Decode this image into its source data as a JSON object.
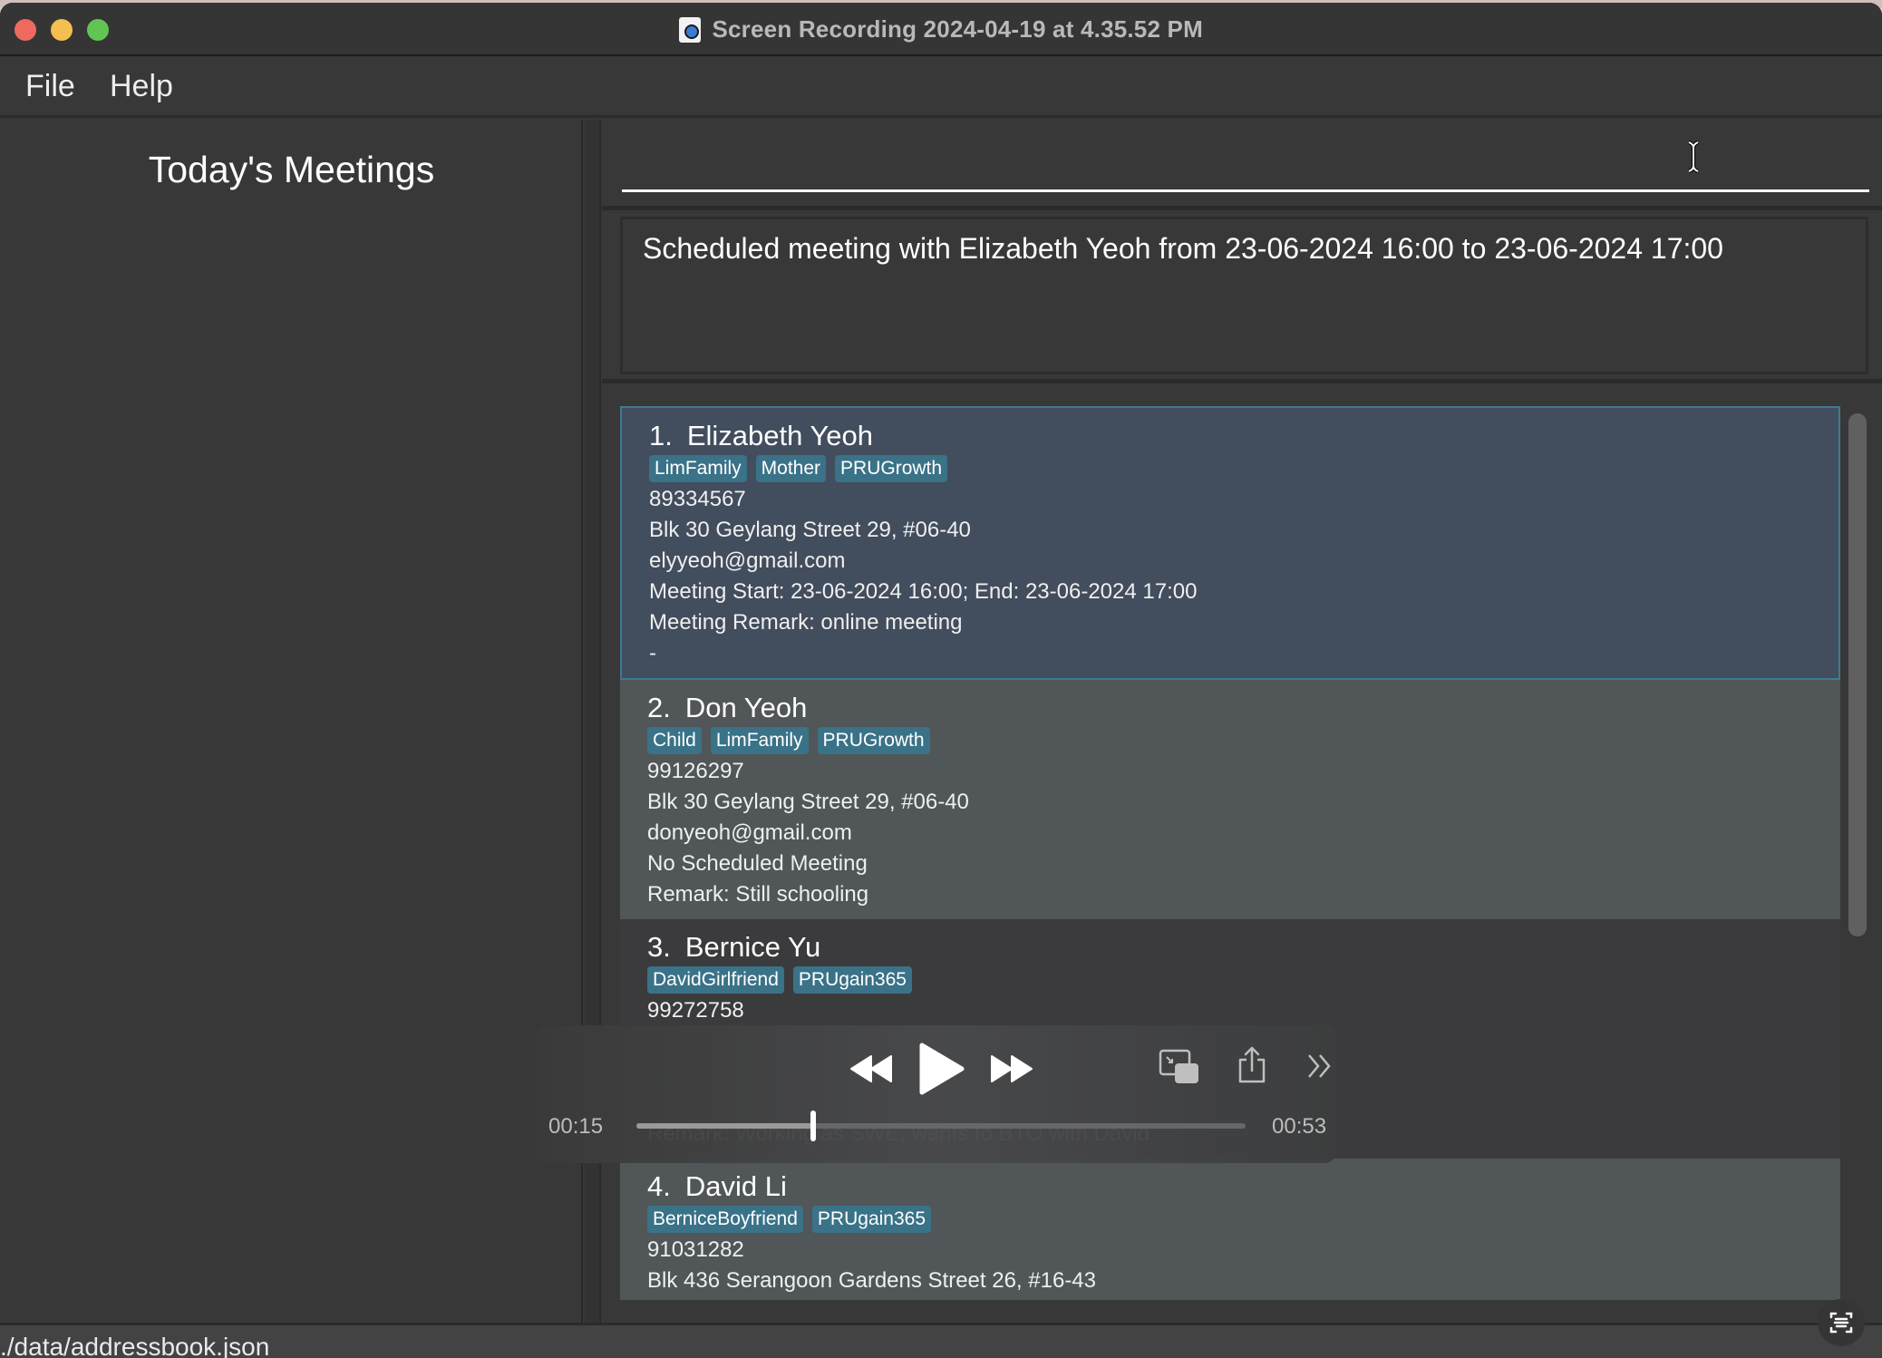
{
  "window": {
    "title": "Screen Recording 2024-04-19 at 4.35.52 PM"
  },
  "menu": {
    "items": [
      {
        "label": "File"
      },
      {
        "label": "Help"
      }
    ]
  },
  "left_panel": {
    "title": "Today's Meetings"
  },
  "command": {
    "value": "",
    "placeholder": ""
  },
  "result": {
    "message": "Scheduled meeting with Elizabeth Yeoh from 23-06-2024 16:00 to 23-06-2024 17:00"
  },
  "persons": [
    {
      "index": "1.",
      "name": "Elizabeth Yeoh",
      "tags": [
        "LimFamily",
        "Mother",
        "PRUGrowth"
      ],
      "fields": [
        "89334567",
        "Blk 30 Geylang Street 29, #06-40",
        "elyyeoh@gmail.com",
        "Meeting Start: 23-06-2024 16:00; End: 23-06-2024 17:00",
        "Meeting Remark: online meeting",
        "-"
      ],
      "selected": true
    },
    {
      "index": "2.",
      "name": "Don Yeoh",
      "tags": [
        "Child",
        "LimFamily",
        "PRUGrowth"
      ],
      "fields": [
        "99126297",
        "Blk 30 Geylang Street 29, #06-40",
        "donyeoh@gmail.com",
        "No Scheduled Meeting",
        "Remark: Still schooling"
      ],
      "selected": false
    },
    {
      "index": "3.",
      "name": "Bernice Yu",
      "tags": [
        "DavidGirlfriend",
        "PRUgain365"
      ],
      "fields": [
        "99272758",
        "",
        "",
        "",
        "Remark: Working as SWE, wants to BTO with David"
      ],
      "selected": false
    },
    {
      "index": "4.",
      "name": "David Li",
      "tags": [
        "BerniceBoyfriend",
        "PRUgain365"
      ],
      "fields": [
        "91031282",
        "Blk 436 Serangoon Gardens Street 26, #16-43"
      ],
      "selected": false
    }
  ],
  "status_bar": {
    "path": "./data/addressbook.json"
  },
  "player": {
    "current_time": "00:15",
    "duration": "00:53",
    "progress_fraction": 0.29,
    "icons": [
      "rewind-icon",
      "play-icon",
      "fast-forward-icon",
      "picture-in-picture-icon",
      "share-icon",
      "more-icon"
    ]
  },
  "colors": {
    "selected_card_bg": "#424d5d",
    "selected_card_border": "#3e7b91",
    "tag_bg": "#3a7288",
    "card_even_bg": "#515658",
    "card_odd_bg": "#3b3b3d"
  }
}
